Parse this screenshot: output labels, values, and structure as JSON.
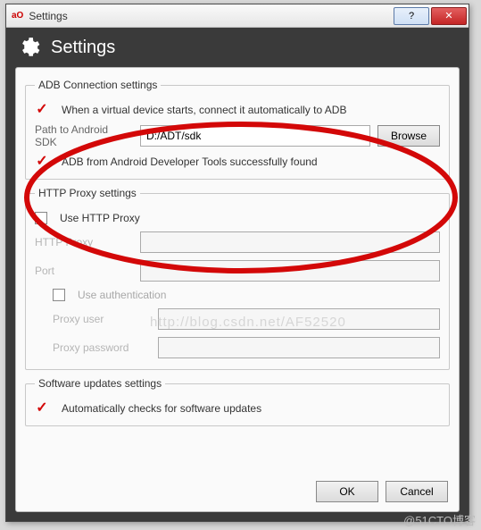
{
  "titlebar": {
    "title": "Settings",
    "help_symbol": "?",
    "close_symbol": "✕"
  },
  "header": {
    "title": "Settings"
  },
  "adb": {
    "legend": "ADB Connection settings",
    "auto_connect_label": "When a virtual device starts, connect it automatically to ADB",
    "path_label": "Path to Android SDK",
    "path_value": "D:/ADT/sdk",
    "browse_label": "Browse",
    "status_text": "ADB from Android Developer Tools successfully found"
  },
  "proxy": {
    "legend": "HTTP Proxy settings",
    "use_proxy_label": "Use HTTP Proxy",
    "http_proxy_label": "HTTP Proxy",
    "port_label": "Port",
    "use_auth_label": "Use authentication",
    "proxy_user_label": "Proxy user",
    "proxy_password_label": "Proxy password"
  },
  "updates": {
    "legend": "Software updates settings",
    "auto_check_label": "Automatically checks for software updates"
  },
  "footer": {
    "ok_label": "OK",
    "cancel_label": "Cancel"
  },
  "watermark": {
    "text": "http://blog.csdn.net/AF52520",
    "corner": "@51CTO博客"
  }
}
